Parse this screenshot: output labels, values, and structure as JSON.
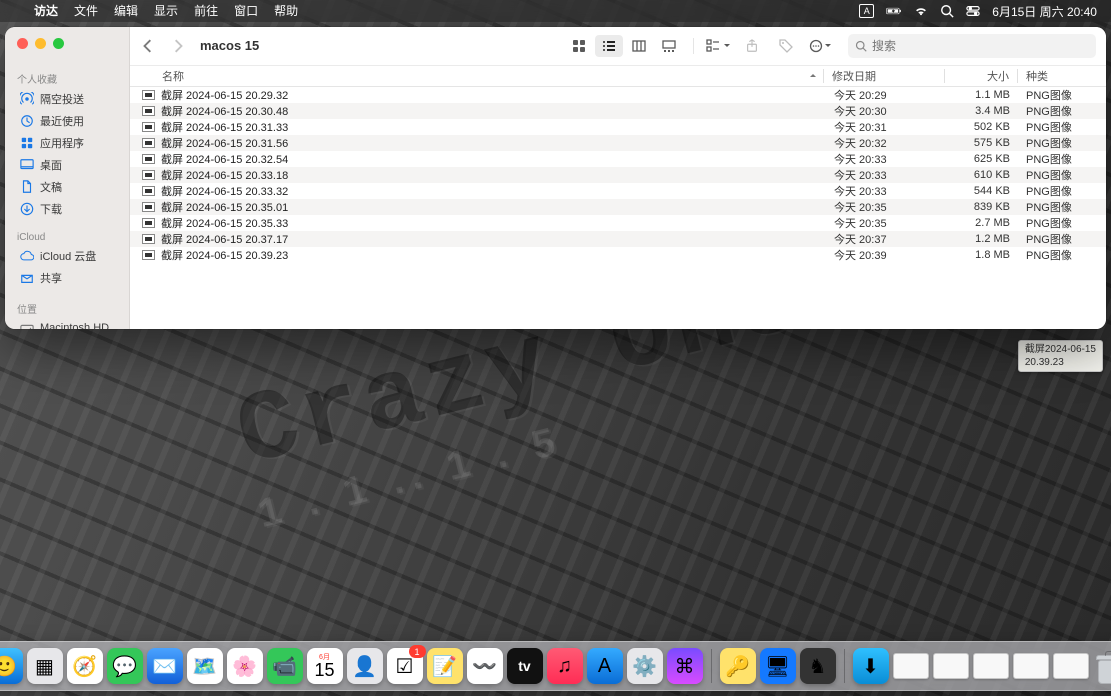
{
  "menubar": {
    "app": "访达",
    "items": [
      "文件",
      "编辑",
      "显示",
      "前往",
      "窗口",
      "帮助"
    ],
    "input_indicator": "A",
    "date": "6月15日 周六 20:40"
  },
  "finder": {
    "title": "macos 15",
    "search_placeholder": "搜索",
    "sidebar": {
      "favorites_title": "个人收藏",
      "favorites": [
        {
          "icon": "airdrop",
          "label": "隔空投送"
        },
        {
          "icon": "clock",
          "label": "最近使用"
        },
        {
          "icon": "apps",
          "label": "应用程序"
        },
        {
          "icon": "desktop",
          "label": "桌面"
        },
        {
          "icon": "doc",
          "label": "文稿"
        },
        {
          "icon": "download",
          "label": "下载"
        }
      ],
      "icloud_title": "iCloud",
      "icloud": [
        {
          "icon": "cloud",
          "label": "iCloud 云盘"
        },
        {
          "icon": "share",
          "label": "共享"
        }
      ],
      "locations_title": "位置",
      "locations": [
        {
          "icon": "hdd",
          "label": "Macintosh HD"
        }
      ]
    },
    "columns": {
      "name": "名称",
      "date": "修改日期",
      "size": "大小",
      "kind": "种类"
    },
    "files": [
      {
        "name": "截屏 2024-06-15 20.29.32",
        "date": "今天 20:29",
        "size": "1.1 MB",
        "kind": "PNG图像"
      },
      {
        "name": "截屏 2024-06-15 20.30.48",
        "date": "今天 20:30",
        "size": "3.4 MB",
        "kind": "PNG图像"
      },
      {
        "name": "截屏 2024-06-15 20.31.33",
        "date": "今天 20:31",
        "size": "502 KB",
        "kind": "PNG图像"
      },
      {
        "name": "截屏 2024-06-15 20.31.56",
        "date": "今天 20:32",
        "size": "575 KB",
        "kind": "PNG图像"
      },
      {
        "name": "截屏 2024-06-15 20.32.54",
        "date": "今天 20:33",
        "size": "625 KB",
        "kind": "PNG图像"
      },
      {
        "name": "截屏 2024-06-15 20.33.18",
        "date": "今天 20:33",
        "size": "610 KB",
        "kind": "PNG图像"
      },
      {
        "name": "截屏 2024-06-15 20.33.32",
        "date": "今天 20:33",
        "size": "544 KB",
        "kind": "PNG图像"
      },
      {
        "name": "截屏 2024-06-15 20.35.01",
        "date": "今天 20:35",
        "size": "839 KB",
        "kind": "PNG图像"
      },
      {
        "name": "截屏 2024-06-15 20.35.33",
        "date": "今天 20:35",
        "size": "2.7 MB",
        "kind": "PNG图像"
      },
      {
        "name": "截屏 2024-06-15 20.37.17",
        "date": "今天 20:37",
        "size": "1.2 MB",
        "kind": "PNG图像"
      },
      {
        "name": "截屏 2024-06-15 20.39.23",
        "date": "今天 20:39",
        "size": "1.8 MB",
        "kind": "PNG图像"
      }
    ]
  },
  "tooltip": {
    "line1": "截屏2024-06-15",
    "line2": "20.39.23"
  },
  "dock": {
    "apps": [
      {
        "name": "finder",
        "bg": "linear-gradient(#3fc0ff,#0a6dd6)",
        "emoji": "🙂"
      },
      {
        "name": "launchpad",
        "bg": "#e7e7ea",
        "emoji": "▦"
      },
      {
        "name": "safari",
        "bg": "#fff",
        "emoji": "🧭"
      },
      {
        "name": "messages",
        "bg": "#34c759",
        "emoji": "💬"
      },
      {
        "name": "mail",
        "bg": "linear-gradient(#4aa3ff,#1260d8)",
        "emoji": "✉️"
      },
      {
        "name": "maps",
        "bg": "#fff",
        "emoji": "🗺️"
      },
      {
        "name": "photos",
        "bg": "#fff",
        "emoji": "🌸"
      },
      {
        "name": "facetime",
        "bg": "#34c759",
        "emoji": "📹"
      },
      {
        "name": "calendar",
        "bg": "#fff",
        "emoji": "15",
        "label": "15",
        "badge": "",
        "sub": "6月"
      },
      {
        "name": "contacts",
        "bg": "#e7e7ea",
        "emoji": "👤"
      },
      {
        "name": "reminders",
        "bg": "#fff",
        "emoji": "☑︎",
        "badge": "1"
      },
      {
        "name": "notes",
        "bg": "#ffe26b",
        "emoji": "📝"
      },
      {
        "name": "freeform",
        "bg": "#fff",
        "emoji": "〰️"
      },
      {
        "name": "tv",
        "bg": "#111",
        "emoji": "tv",
        "label": "tv"
      },
      {
        "name": "music",
        "bg": "linear-gradient(#ff5a74,#ff2d55)",
        "emoji": "♫"
      },
      {
        "name": "appstore",
        "bg": "linear-gradient(#34aaff,#0a6dd6)",
        "emoji": "A"
      },
      {
        "name": "settings",
        "bg": "#e7e7ea",
        "emoji": "⚙️"
      },
      {
        "name": "shortcut",
        "bg": "linear-gradient(#7a4bff,#d84bff)",
        "emoji": "⌘"
      }
    ],
    "recent": [
      {
        "name": "passwords",
        "bg": "#ffe26b",
        "emoji": "🔑"
      },
      {
        "name": "screensharing",
        "bg": "#1479ff",
        "emoji": "🖥"
      },
      {
        "name": "chess",
        "bg": "#333",
        "emoji": "♞"
      }
    ],
    "mini_count": 5,
    "downloads": {
      "bg": "linear-gradient(#2fc0ff,#0a8dd6)",
      "emoji": "⬇︎"
    }
  }
}
